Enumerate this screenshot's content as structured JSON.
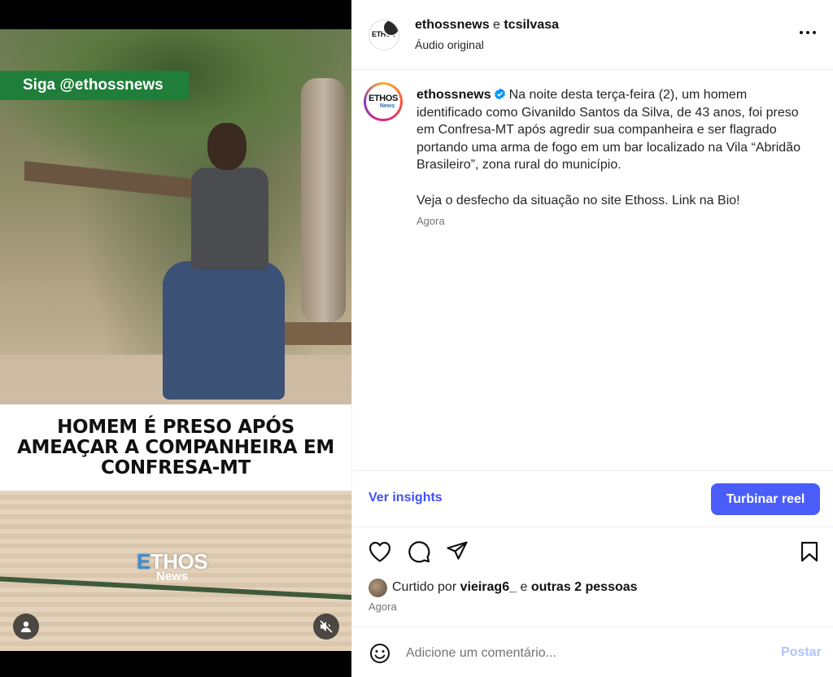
{
  "video": {
    "follow_badge": "Siga @ethossnews",
    "headline_line1": "HOMEM É PRESO APÓS",
    "headline_line2": "AMEAÇAR A COMPANHEIRA EM",
    "headline_line3": "CONFRESA-MT",
    "watermark_e": "E",
    "watermark_brand": "THOS",
    "watermark_sub": "News",
    "profile_icon": "person-icon",
    "mute_icon": "speaker-muted-icon"
  },
  "header": {
    "user1": "ethossnews",
    "connector": "e",
    "user2": "tcsilvasa",
    "audio": "Áudio original",
    "avatar_text": "ETHOS"
  },
  "caption": {
    "avatar_line1": "ETHOS",
    "avatar_line2": "News",
    "username": "ethossnews",
    "paragraph1": "Na noite desta terça-feira (2), um homem identificado como Givanildo Santos da Silva, de 43 anos, foi preso em Confresa-MT após agredir sua companheira e ser flagrado portando uma arma de fogo em um bar localizado na Vila “Abridão Brasileiro”, zona rural do município.",
    "paragraph2": "Veja o desfecho da situação no site Ethoss. Link na Bio!",
    "time": "Agora"
  },
  "insights": {
    "link": "Ver insights",
    "boost": "Turbinar reel"
  },
  "likes": {
    "prefix": "Curtido por",
    "user": "vieirag6_",
    "connector": "e",
    "others": "outras 2 pessoas"
  },
  "post_time": "Agora",
  "comment": {
    "placeholder": "Adicione um comentário...",
    "post": "Postar"
  },
  "colors": {
    "accent": "#4a5df9",
    "link": "#4150f7",
    "badge_green": "#1e7e3a",
    "verified": "#0095f6"
  }
}
